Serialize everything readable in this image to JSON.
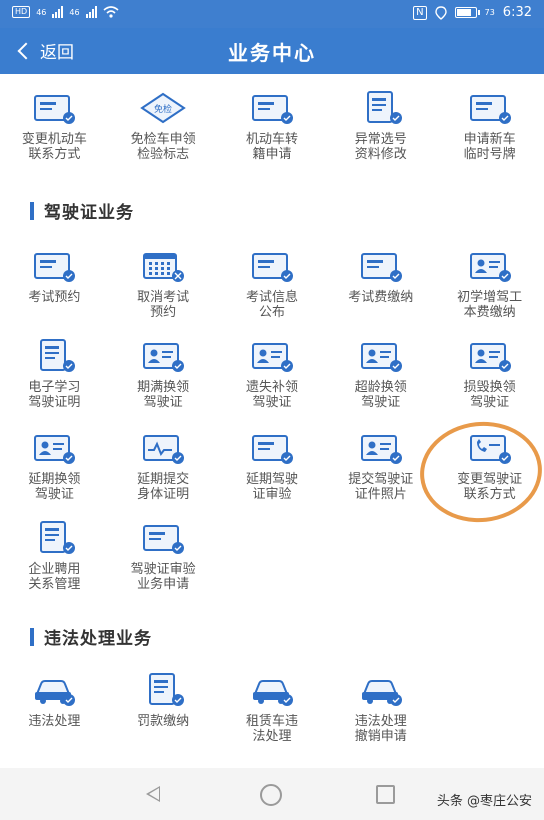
{
  "status_bar": {
    "sim1": "HD",
    "sim2": "HD",
    "sig1": "46",
    "sig2": "46",
    "nfc": "N",
    "battery": "73",
    "time": "6:32"
  },
  "header": {
    "back_label": "返回",
    "title": "业务中心"
  },
  "vehicle_row": [
    {
      "icon": "card-refresh-icon",
      "line1": "变更机动车",
      "line2": "联系方式"
    },
    {
      "icon": "exempt-badge-icon",
      "line1": "免检车申领",
      "line2": "检验标志",
      "badge": "免检"
    },
    {
      "icon": "card-transfer-icon",
      "line1": "机动车转",
      "line2": "籍申请"
    },
    {
      "icon": "document-edit-icon",
      "line1": "异常选号",
      "line2": "资料修改"
    },
    {
      "icon": "plate-add-icon",
      "line1": "申请新车",
      "line2": "临时号牌"
    }
  ],
  "license_section": {
    "title": "驾驶证业务"
  },
  "license_rows": [
    [
      {
        "icon": "card-reserve-icon",
        "line1": "考试预约",
        "line2": ""
      },
      {
        "icon": "calendar-cancel-icon",
        "line1": "取消考试",
        "line2": "预约"
      },
      {
        "icon": "card-announce-icon",
        "line1": "考试信息",
        "line2": "公布"
      },
      {
        "icon": "card-pay-icon",
        "line1": "考试费缴纳",
        "line2": ""
      },
      {
        "icon": "card-fee-icon",
        "line1": "初学增驾工",
        "line2": "本费缴纳"
      }
    ],
    [
      {
        "icon": "id-study-icon",
        "line1": "电子学习",
        "line2": "驾驶证明"
      },
      {
        "icon": "card-renew-icon",
        "line1": "期满换领",
        "line2": "驾驶证"
      },
      {
        "icon": "card-lost-icon",
        "line1": "遗失补领",
        "line2": "驾驶证"
      },
      {
        "icon": "card-age-icon",
        "line1": "超龄换领",
        "line2": "驾驶证"
      },
      {
        "icon": "card-damaged-icon",
        "line1": "损毁换领",
        "line2": "驾驶证"
      }
    ],
    [
      {
        "icon": "card-delay-icon",
        "line1": "延期换领",
        "line2": "驾驶证"
      },
      {
        "icon": "health-delay-icon",
        "line1": "延期提交",
        "line2": "身体证明"
      },
      {
        "icon": "card-review-delay-icon",
        "line1": "延期驾驶",
        "line2": "证审验"
      },
      {
        "icon": "photo-upload-icon",
        "line1": "提交驾驶证",
        "line2": "证件照片"
      },
      {
        "icon": "phone-card-icon",
        "line1": "变更驾驶证",
        "line2": "联系方式"
      }
    ],
    [
      {
        "icon": "enterprise-icon",
        "line1": "企业聘用",
        "line2": "关系管理"
      },
      {
        "icon": "card-audit-icon",
        "line1": "驾驶证审验",
        "line2": "业务申请"
      }
    ]
  ],
  "violation_section": {
    "title": "违法处理业务"
  },
  "violation_row": [
    {
      "icon": "car-violation-icon",
      "line1": "违法处理",
      "line2": ""
    },
    {
      "icon": "fine-pay-icon",
      "line1": "罚款缴纳",
      "line2": ""
    },
    {
      "icon": "rental-car-icon",
      "line1": "租赁车违",
      "line2": "法处理"
    },
    {
      "icon": "revoke-car-icon",
      "line1": "违法处理",
      "line2": "撤销申请"
    }
  ],
  "watermark": "头条 @枣庄公安",
  "colors": {
    "header": "#3a7dcf",
    "icon_blue": "#2f6fc6",
    "highlight": "#e89a4a"
  }
}
